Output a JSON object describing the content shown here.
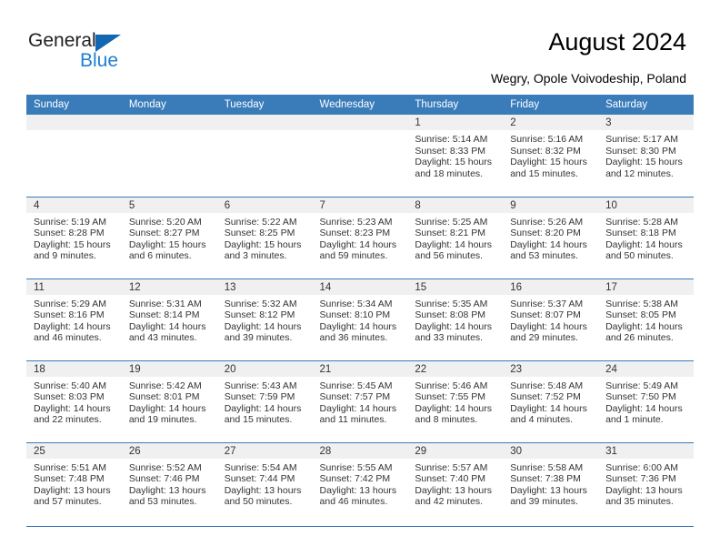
{
  "brand": {
    "name_part1": "General",
    "name_part2": "Blue",
    "accent_color": "#1f7fd0",
    "triangle_color": "#1267b2"
  },
  "header": {
    "title": "August 2024",
    "subtitle": "Wegry, Opole Voivodeship, Poland",
    "header_bg": "#3a7cba",
    "header_text_color": "#ffffff"
  },
  "weekdays": [
    "Sunday",
    "Monday",
    "Tuesday",
    "Wednesday",
    "Thursday",
    "Friday",
    "Saturday"
  ],
  "weeks": [
    [
      {
        "day": "",
        "empty": true
      },
      {
        "day": "",
        "empty": true
      },
      {
        "day": "",
        "empty": true
      },
      {
        "day": "",
        "empty": true
      },
      {
        "day": "1",
        "sunrise": "Sunrise: 5:14 AM",
        "sunset": "Sunset: 8:33 PM",
        "daylight_1": "Daylight: 15 hours",
        "daylight_2": "and 18 minutes."
      },
      {
        "day": "2",
        "sunrise": "Sunrise: 5:16 AM",
        "sunset": "Sunset: 8:32 PM",
        "daylight_1": "Daylight: 15 hours",
        "daylight_2": "and 15 minutes."
      },
      {
        "day": "3",
        "sunrise": "Sunrise: 5:17 AM",
        "sunset": "Sunset: 8:30 PM",
        "daylight_1": "Daylight: 15 hours",
        "daylight_2": "and 12 minutes."
      }
    ],
    [
      {
        "day": "4",
        "sunrise": "Sunrise: 5:19 AM",
        "sunset": "Sunset: 8:28 PM",
        "daylight_1": "Daylight: 15 hours",
        "daylight_2": "and 9 minutes."
      },
      {
        "day": "5",
        "sunrise": "Sunrise: 5:20 AM",
        "sunset": "Sunset: 8:27 PM",
        "daylight_1": "Daylight: 15 hours",
        "daylight_2": "and 6 minutes."
      },
      {
        "day": "6",
        "sunrise": "Sunrise: 5:22 AM",
        "sunset": "Sunset: 8:25 PM",
        "daylight_1": "Daylight: 15 hours",
        "daylight_2": "and 3 minutes."
      },
      {
        "day": "7",
        "sunrise": "Sunrise: 5:23 AM",
        "sunset": "Sunset: 8:23 PM",
        "daylight_1": "Daylight: 14 hours",
        "daylight_2": "and 59 minutes."
      },
      {
        "day": "8",
        "sunrise": "Sunrise: 5:25 AM",
        "sunset": "Sunset: 8:21 PM",
        "daylight_1": "Daylight: 14 hours",
        "daylight_2": "and 56 minutes."
      },
      {
        "day": "9",
        "sunrise": "Sunrise: 5:26 AM",
        "sunset": "Sunset: 8:20 PM",
        "daylight_1": "Daylight: 14 hours",
        "daylight_2": "and 53 minutes."
      },
      {
        "day": "10",
        "sunrise": "Sunrise: 5:28 AM",
        "sunset": "Sunset: 8:18 PM",
        "daylight_1": "Daylight: 14 hours",
        "daylight_2": "and 50 minutes."
      }
    ],
    [
      {
        "day": "11",
        "sunrise": "Sunrise: 5:29 AM",
        "sunset": "Sunset: 8:16 PM",
        "daylight_1": "Daylight: 14 hours",
        "daylight_2": "and 46 minutes."
      },
      {
        "day": "12",
        "sunrise": "Sunrise: 5:31 AM",
        "sunset": "Sunset: 8:14 PM",
        "daylight_1": "Daylight: 14 hours",
        "daylight_2": "and 43 minutes."
      },
      {
        "day": "13",
        "sunrise": "Sunrise: 5:32 AM",
        "sunset": "Sunset: 8:12 PM",
        "daylight_1": "Daylight: 14 hours",
        "daylight_2": "and 39 minutes."
      },
      {
        "day": "14",
        "sunrise": "Sunrise: 5:34 AM",
        "sunset": "Sunset: 8:10 PM",
        "daylight_1": "Daylight: 14 hours",
        "daylight_2": "and 36 minutes."
      },
      {
        "day": "15",
        "sunrise": "Sunrise: 5:35 AM",
        "sunset": "Sunset: 8:08 PM",
        "daylight_1": "Daylight: 14 hours",
        "daylight_2": "and 33 minutes."
      },
      {
        "day": "16",
        "sunrise": "Sunrise: 5:37 AM",
        "sunset": "Sunset: 8:07 PM",
        "daylight_1": "Daylight: 14 hours",
        "daylight_2": "and 29 minutes."
      },
      {
        "day": "17",
        "sunrise": "Sunrise: 5:38 AM",
        "sunset": "Sunset: 8:05 PM",
        "daylight_1": "Daylight: 14 hours",
        "daylight_2": "and 26 minutes."
      }
    ],
    [
      {
        "day": "18",
        "sunrise": "Sunrise: 5:40 AM",
        "sunset": "Sunset: 8:03 PM",
        "daylight_1": "Daylight: 14 hours",
        "daylight_2": "and 22 minutes."
      },
      {
        "day": "19",
        "sunrise": "Sunrise: 5:42 AM",
        "sunset": "Sunset: 8:01 PM",
        "daylight_1": "Daylight: 14 hours",
        "daylight_2": "and 19 minutes."
      },
      {
        "day": "20",
        "sunrise": "Sunrise: 5:43 AM",
        "sunset": "Sunset: 7:59 PM",
        "daylight_1": "Daylight: 14 hours",
        "daylight_2": "and 15 minutes."
      },
      {
        "day": "21",
        "sunrise": "Sunrise: 5:45 AM",
        "sunset": "Sunset: 7:57 PM",
        "daylight_1": "Daylight: 14 hours",
        "daylight_2": "and 11 minutes."
      },
      {
        "day": "22",
        "sunrise": "Sunrise: 5:46 AM",
        "sunset": "Sunset: 7:55 PM",
        "daylight_1": "Daylight: 14 hours",
        "daylight_2": "and 8 minutes."
      },
      {
        "day": "23",
        "sunrise": "Sunrise: 5:48 AM",
        "sunset": "Sunset: 7:52 PM",
        "daylight_1": "Daylight: 14 hours",
        "daylight_2": "and 4 minutes."
      },
      {
        "day": "24",
        "sunrise": "Sunrise: 5:49 AM",
        "sunset": "Sunset: 7:50 PM",
        "daylight_1": "Daylight: 14 hours",
        "daylight_2": "and 1 minute."
      }
    ],
    [
      {
        "day": "25",
        "sunrise": "Sunrise: 5:51 AM",
        "sunset": "Sunset: 7:48 PM",
        "daylight_1": "Daylight: 13 hours",
        "daylight_2": "and 57 minutes."
      },
      {
        "day": "26",
        "sunrise": "Sunrise: 5:52 AM",
        "sunset": "Sunset: 7:46 PM",
        "daylight_1": "Daylight: 13 hours",
        "daylight_2": "and 53 minutes."
      },
      {
        "day": "27",
        "sunrise": "Sunrise: 5:54 AM",
        "sunset": "Sunset: 7:44 PM",
        "daylight_1": "Daylight: 13 hours",
        "daylight_2": "and 50 minutes."
      },
      {
        "day": "28",
        "sunrise": "Sunrise: 5:55 AM",
        "sunset": "Sunset: 7:42 PM",
        "daylight_1": "Daylight: 13 hours",
        "daylight_2": "and 46 minutes."
      },
      {
        "day": "29",
        "sunrise": "Sunrise: 5:57 AM",
        "sunset": "Sunset: 7:40 PM",
        "daylight_1": "Daylight: 13 hours",
        "daylight_2": "and 42 minutes."
      },
      {
        "day": "30",
        "sunrise": "Sunrise: 5:58 AM",
        "sunset": "Sunset: 7:38 PM",
        "daylight_1": "Daylight: 13 hours",
        "daylight_2": "and 39 minutes."
      },
      {
        "day": "31",
        "sunrise": "Sunrise: 6:00 AM",
        "sunset": "Sunset: 7:36 PM",
        "daylight_1": "Daylight: 13 hours",
        "daylight_2": "and 35 minutes."
      }
    ]
  ]
}
